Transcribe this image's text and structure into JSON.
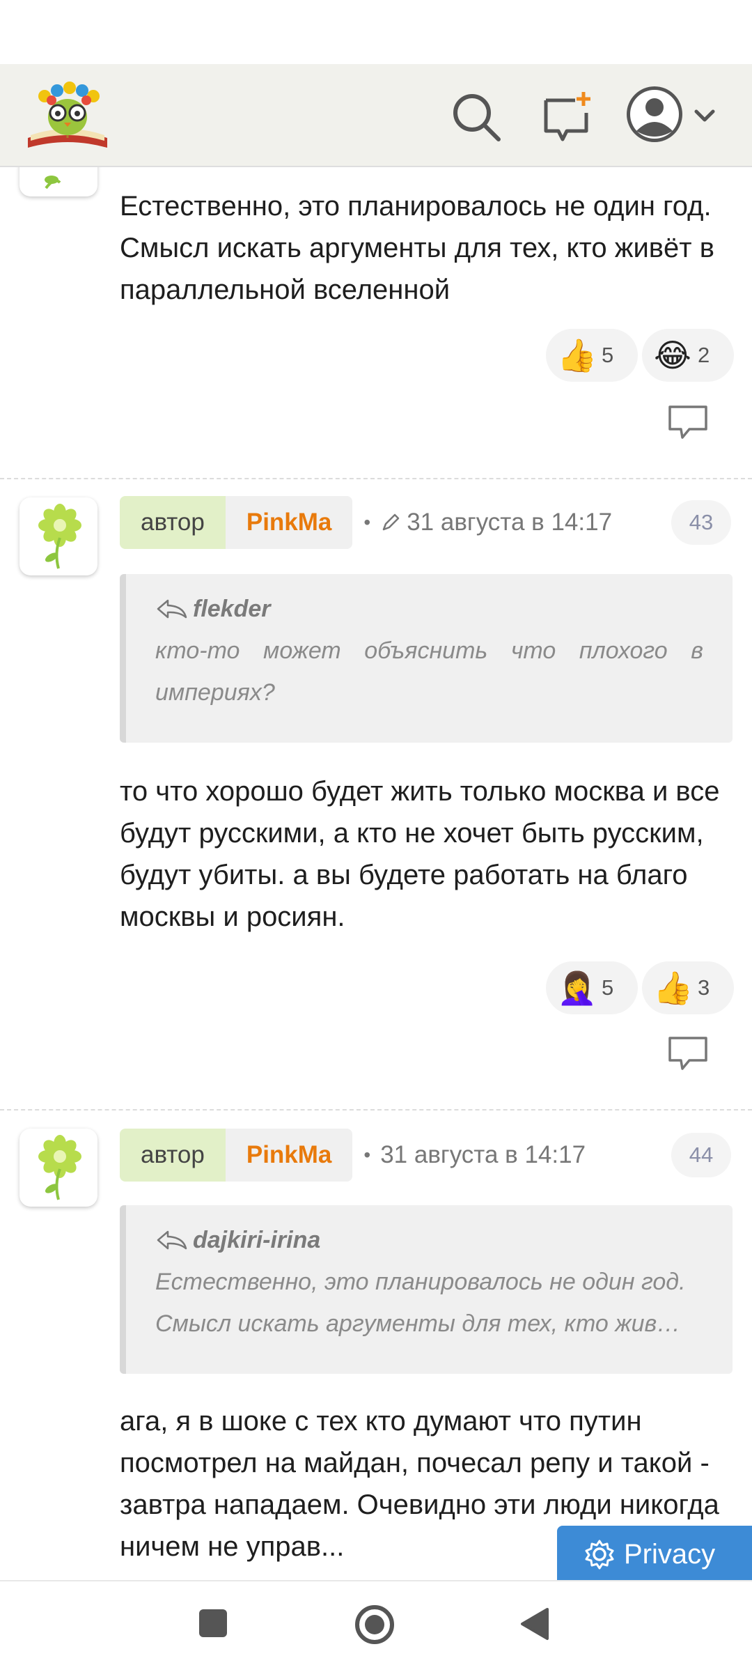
{
  "header": {
    "logo": "book-owl-logo",
    "icons": [
      "search-icon",
      "new-post-icon",
      "user-avatar-icon",
      "chevron-down-icon"
    ]
  },
  "comments": [
    {
      "text": "Естественно, это планировалось не один год. Смысл искать аргументы для тех, кто живёт в параллельной вселенной",
      "reactions": [
        {
          "emoji": "👍",
          "count": "5"
        },
        {
          "emoji": "😂",
          "count": "2"
        }
      ]
    },
    {
      "author_label": "автор",
      "nick": "PinkMa",
      "separator": "•",
      "date": "31 августа в 14:17",
      "number": "43",
      "quote_author": "flekder",
      "quote_text": "кто-то может объяснить что плохого в империях?",
      "text": "то что хорошо будет жить только москва и все будут русскими, а кто не хочет быть русским, будут убиты. а вы будете работать на благо москвы и росиян.",
      "reactions": [
        {
          "emoji": "🤦‍♀️",
          "count": "5"
        },
        {
          "emoji": "👍",
          "count": "3"
        }
      ]
    },
    {
      "author_label": "автор",
      "nick": "PinkMa",
      "separator": "•",
      "date": "31 августа в 14:17",
      "number": "44",
      "quote_author": "dajkiri-irina",
      "quote_text": "Естественно, это планировалось не один год. Смысл искать аргументы для тех, кто жив…",
      "text": "ага, я в шоке с тех кто думают что путин посмотрел на майдан, почесал репу и такой - завтра нападаем. Очевидно эти люди никогда ничем не управ..."
    }
  ],
  "privacy_button": "Privacy",
  "navbar": [
    "recents-icon",
    "home-icon",
    "back-icon"
  ],
  "colors": {
    "header_bg": "#f1f1ec",
    "accent_orange": "#e87a0c",
    "author_green": "#e2f0c8",
    "privacy_blue": "#3d8bd6"
  }
}
